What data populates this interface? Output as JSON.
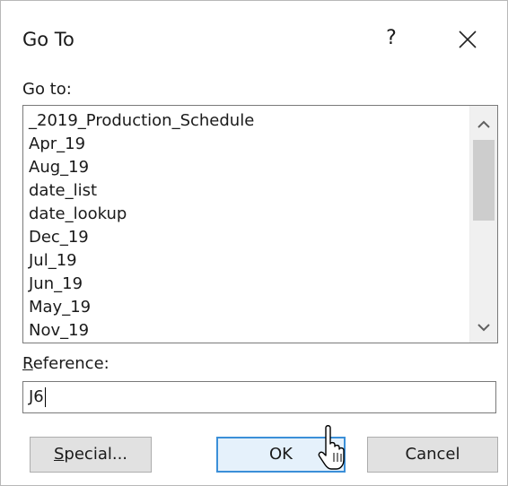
{
  "dialog": {
    "title": "Go To",
    "help_label": "?",
    "close_icon": "close-icon"
  },
  "goto": {
    "label": "Go to:",
    "items": [
      "_2019_Production_Schedule",
      "Apr_19",
      "Aug_19",
      "date_list",
      "date_lookup",
      "Dec_19",
      "Jul_19",
      "Jun_19",
      "May_19",
      "Nov_19"
    ],
    "scroll_up_icon": "chevron-up-icon",
    "scroll_down_icon": "chevron-down-icon"
  },
  "reference": {
    "label_underlined": "R",
    "label_rest": "eference:",
    "value": "J6"
  },
  "buttons": {
    "special_underlined": "S",
    "special_rest": "pecial...",
    "ok": "OK",
    "cancel": "Cancel"
  },
  "colors": {
    "ok_border": "#3b8fd8",
    "ok_background": "#e5f1fb",
    "button_background": "#e1e1e1"
  }
}
